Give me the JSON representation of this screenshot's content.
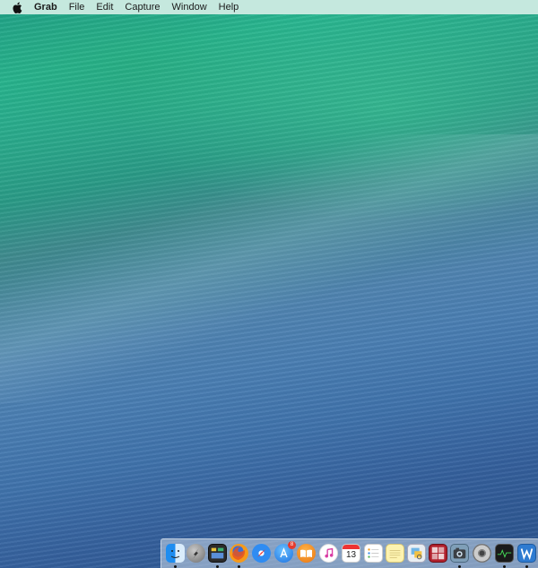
{
  "menubar": {
    "apple_icon": "apple-logo-icon",
    "app_name": "Grab",
    "items": [
      "File",
      "Edit",
      "Capture",
      "Window",
      "Help"
    ]
  },
  "dock": {
    "items": [
      {
        "name": "finder-icon",
        "running": true
      },
      {
        "name": "launchpad-icon",
        "running": false
      },
      {
        "name": "mission-control-icon",
        "running": true
      },
      {
        "name": "firefox-icon",
        "running": true
      },
      {
        "name": "safari-icon",
        "running": false
      },
      {
        "name": "app-store-icon",
        "running": false,
        "badge": "8"
      },
      {
        "name": "ibooks-icon",
        "running": false
      },
      {
        "name": "itunes-icon",
        "running": false
      },
      {
        "name": "calendar-icon",
        "running": false,
        "label": "13"
      },
      {
        "name": "reminders-icon",
        "running": false
      },
      {
        "name": "notes-icon",
        "running": false
      },
      {
        "name": "preview-icon",
        "running": false
      },
      {
        "name": "photo-booth-icon",
        "running": false
      },
      {
        "name": "grab-icon",
        "running": true
      },
      {
        "name": "system-preferences-icon",
        "running": false
      },
      {
        "name": "activity-monitor-icon",
        "running": true
      },
      {
        "name": "word-icon",
        "running": true
      }
    ]
  }
}
